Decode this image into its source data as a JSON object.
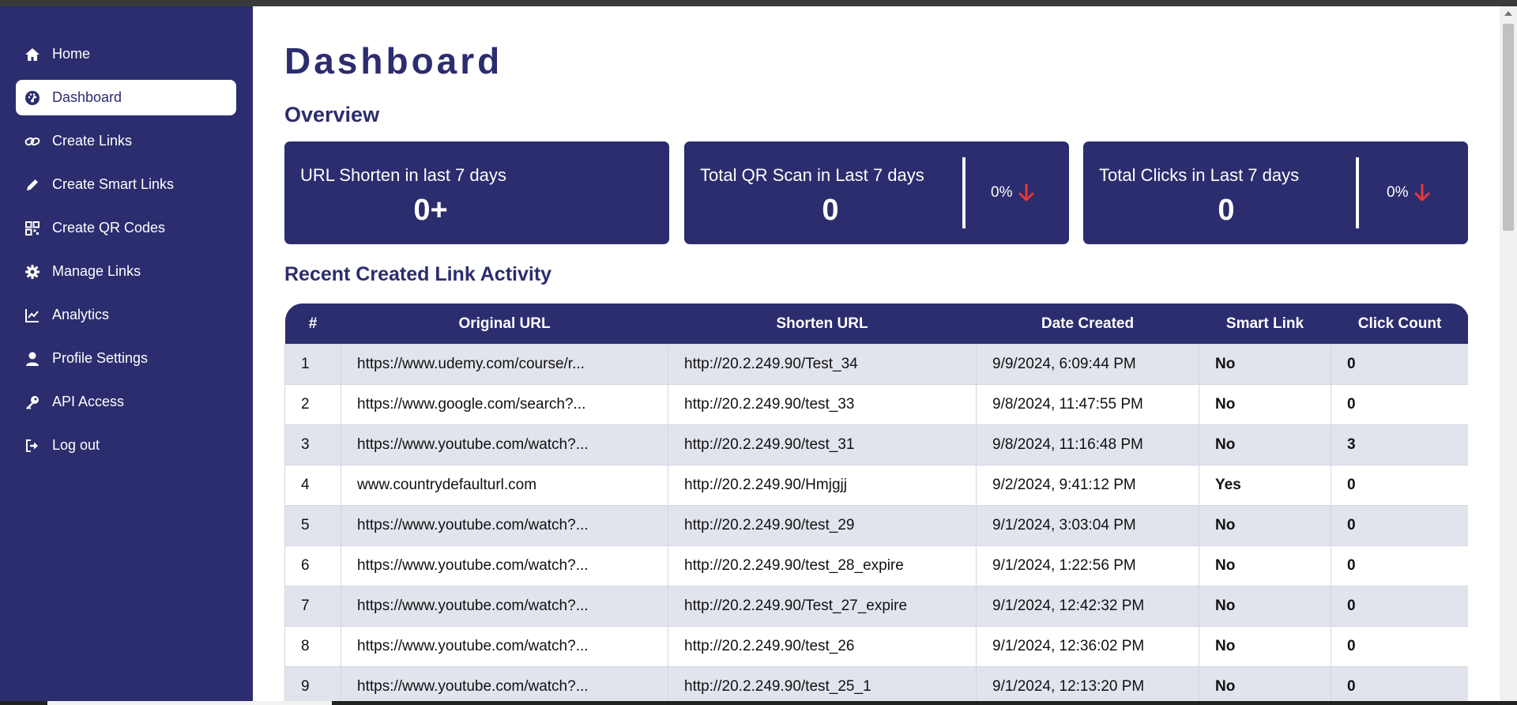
{
  "sidebar": {
    "items": [
      {
        "label": "Home",
        "icon": "home-icon"
      },
      {
        "label": "Dashboard",
        "icon": "gauge-icon",
        "active": true
      },
      {
        "label": "Create Links",
        "icon": "link-icon"
      },
      {
        "label": "Create Smart Links",
        "icon": "pencil-icon"
      },
      {
        "label": "Create QR Codes",
        "icon": "qr-code-icon"
      },
      {
        "label": "Manage Links",
        "icon": "gear-icon"
      },
      {
        "label": "Analytics",
        "icon": "line-chart-icon"
      },
      {
        "label": "Profile Settings",
        "icon": "user-icon"
      },
      {
        "label": "API Access",
        "icon": "key-icon"
      },
      {
        "label": "Log out",
        "icon": "logout-icon"
      }
    ]
  },
  "main": {
    "title": "Dashboard",
    "overview_title": "Overview",
    "cards": [
      {
        "title": "URL Shorten in last 7 days",
        "value": "0+"
      },
      {
        "title": "Total QR Scan in Last 7 days",
        "value": "0",
        "change": "0%"
      },
      {
        "title": "Total Clicks in Last 7 days",
        "value": "0",
        "change": "0%"
      }
    ],
    "recent_title": "Recent Created Link Activity",
    "table": {
      "headers": [
        "#",
        "Original URL",
        "Shorten URL",
        "Date Created",
        "Smart Link",
        "Click Count"
      ],
      "rows": [
        [
          "1",
          "https://www.udemy.com/course/r...",
          "http://20.2.249.90/Test_34",
          "9/9/2024, 6:09:44 PM",
          "No",
          "0"
        ],
        [
          "2",
          "https://www.google.com/search?...",
          "http://20.2.249.90/test_33",
          "9/8/2024, 11:47:55 PM",
          "No",
          "0"
        ],
        [
          "3",
          "https://www.youtube.com/watch?...",
          "http://20.2.249.90/test_31",
          "9/8/2024, 11:16:48 PM",
          "No",
          "3"
        ],
        [
          "4",
          "www.countrydefaulturl.com",
          "http://20.2.249.90/Hmjgjj",
          "9/2/2024, 9:41:12 PM",
          "Yes",
          "0"
        ],
        [
          "5",
          "https://www.youtube.com/watch?...",
          "http://20.2.249.90/test_29",
          "9/1/2024, 3:03:04 PM",
          "No",
          "0"
        ],
        [
          "6",
          "https://www.youtube.com/watch?...",
          "http://20.2.249.90/test_28_expire",
          "9/1/2024, 1:22:56 PM",
          "No",
          "0"
        ],
        [
          "7",
          "https://www.youtube.com/watch?...",
          "http://20.2.249.90/Test_27_expire",
          "9/1/2024, 12:42:32 PM",
          "No",
          "0"
        ],
        [
          "8",
          "https://www.youtube.com/watch?...",
          "http://20.2.249.90/test_26",
          "9/1/2024, 12:36:02 PM",
          "No",
          "0"
        ],
        [
          "9",
          "https://www.youtube.com/watch?...",
          "http://20.2.249.90/test_25_1",
          "9/1/2024, 12:13:20 PM",
          "No",
          "0"
        ]
      ]
    }
  },
  "colors": {
    "primary": "#2b2d6e",
    "row_alt": "#e2e4ed",
    "down_arrow": "#e53935"
  }
}
